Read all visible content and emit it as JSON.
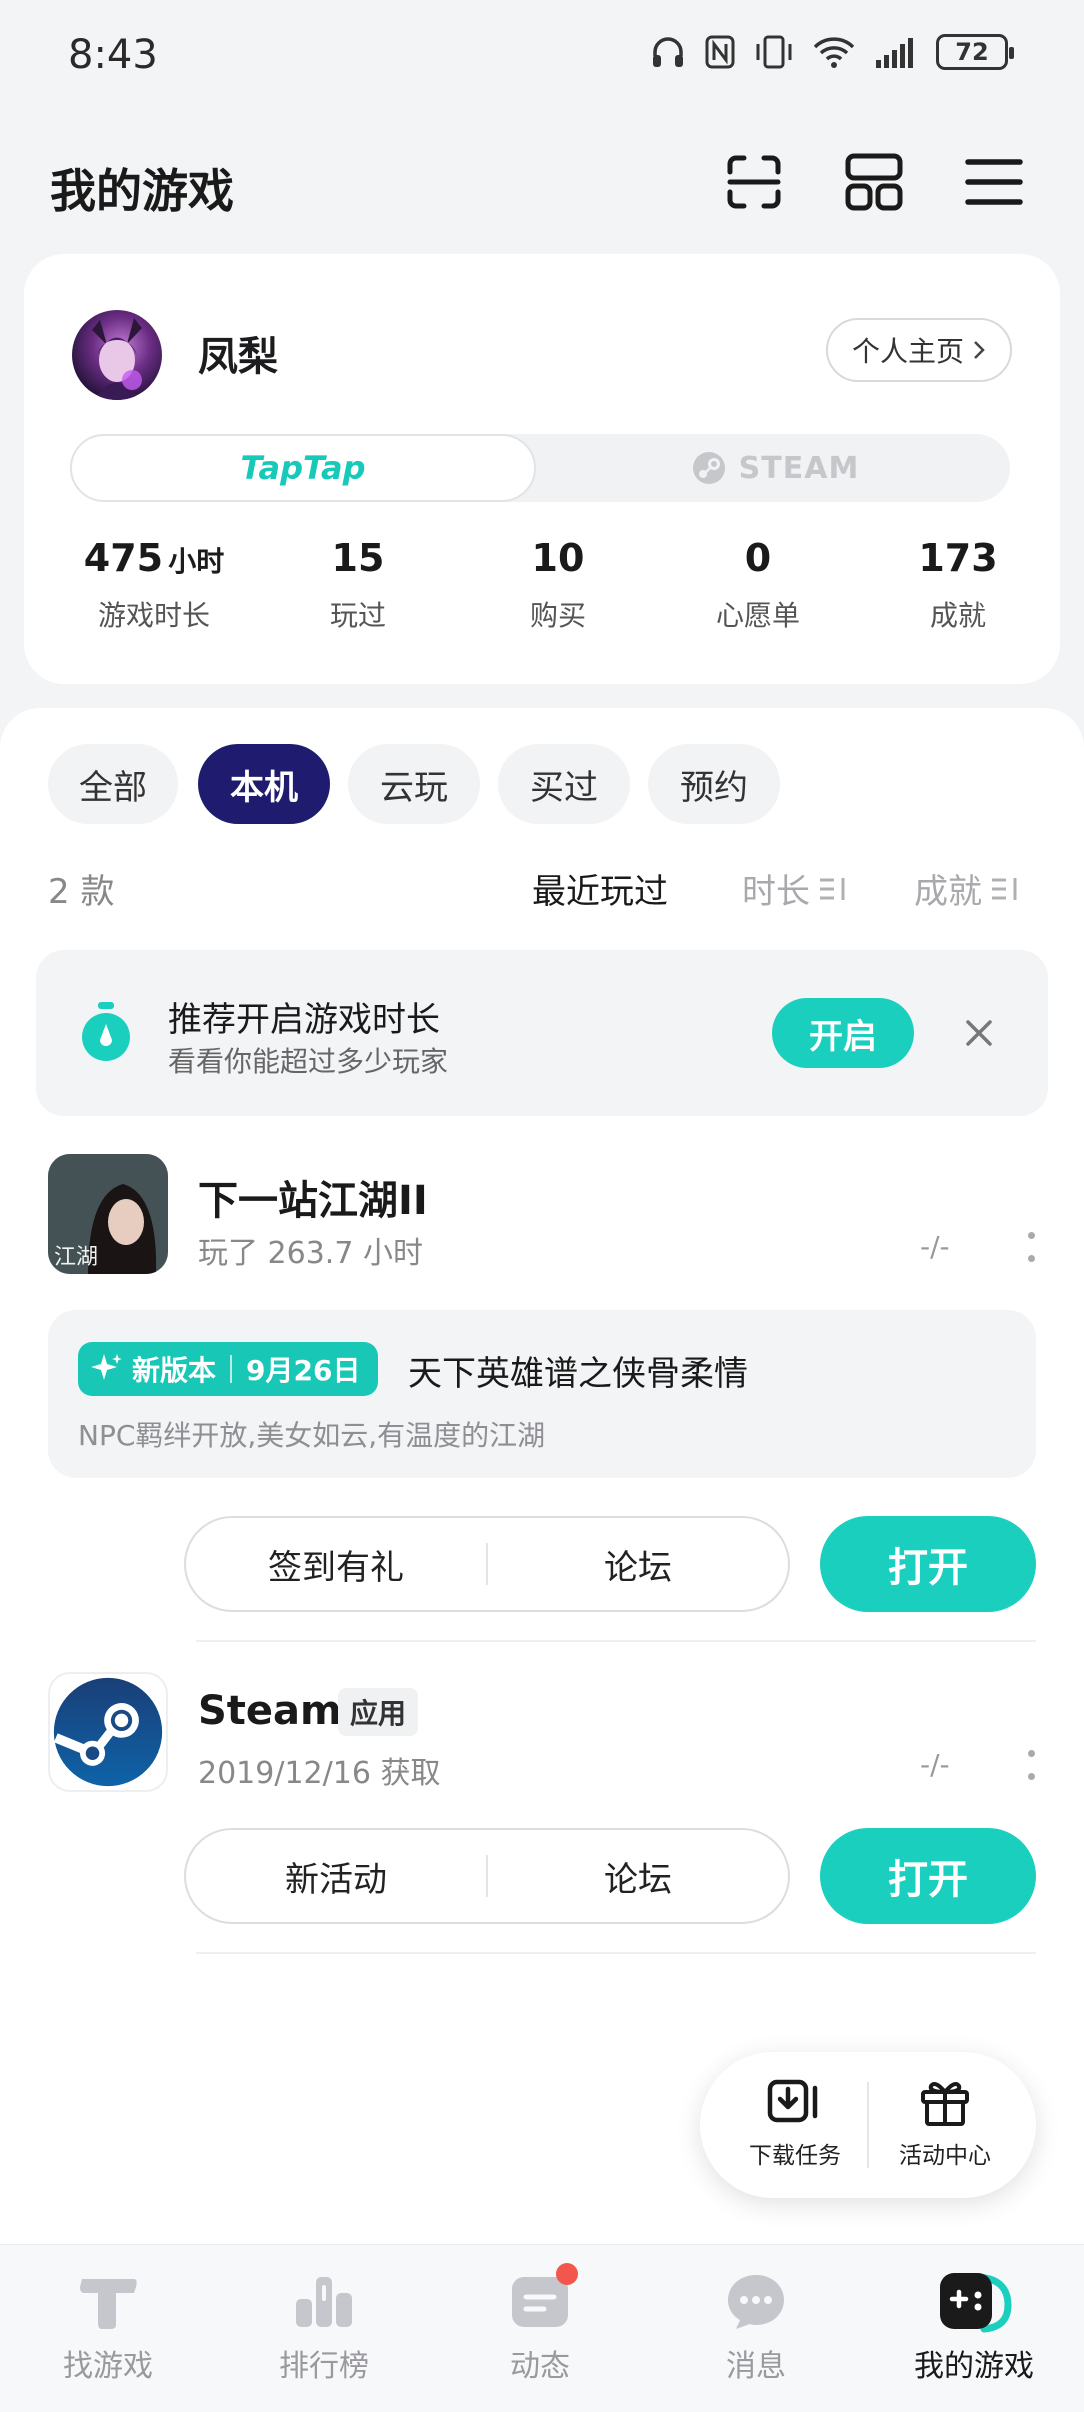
{
  "status_bar": {
    "time": "8:43",
    "battery": "72"
  },
  "header": {
    "title": "我的游戏"
  },
  "profile": {
    "username": "凤梨",
    "homepage_label": "个人主页",
    "platform_tabs": {
      "taptap": "TapTap",
      "steam": "STEAM"
    },
    "stats": [
      {
        "value": "475",
        "unit": "小时",
        "label": "游戏时长"
      },
      {
        "value": "15",
        "label": "玩过"
      },
      {
        "value": "10",
        "label": "购买"
      },
      {
        "value": "0",
        "label": "心愿单"
      },
      {
        "value": "173",
        "label": "成就"
      }
    ]
  },
  "filters": {
    "chips": [
      "全部",
      "本机",
      "云玩",
      "买过",
      "预约"
    ],
    "active": "本机",
    "count": "2 款",
    "sorts": [
      "最近玩过",
      "时长",
      "成就"
    ]
  },
  "recommend": {
    "title": "推荐开启游戏时长",
    "subtitle": "看看你能超过多少玩家",
    "button": "开启"
  },
  "games": [
    {
      "name": "下一站江湖II",
      "meta": "玩了 263.7 小时",
      "rating": "-/-",
      "icon_text": "江湖",
      "update": {
        "badge": "新版本",
        "date": "9月26日",
        "title": "天下英雄谱之侠骨柔情",
        "subtitle": "NPC羁绊开放,美女如云,有温度的江湖"
      },
      "actions": [
        "签到有礼",
        "论坛"
      ],
      "open": "打开"
    },
    {
      "name": "Steam",
      "tag": "应用",
      "meta": "2019/12/16 获取",
      "rating": "-/-",
      "actions": [
        "新活动",
        "论坛"
      ],
      "open": "打开"
    }
  ],
  "float_widget": {
    "download": "下载任务",
    "activity": "活动中心"
  },
  "bottom_nav": [
    "找游戏",
    "排行榜",
    "动态",
    "消息",
    "我的游戏"
  ],
  "colors": {
    "accent": "#1bcfbf",
    "chip_active": "#1f1b6e",
    "notify": "#f2564d"
  }
}
